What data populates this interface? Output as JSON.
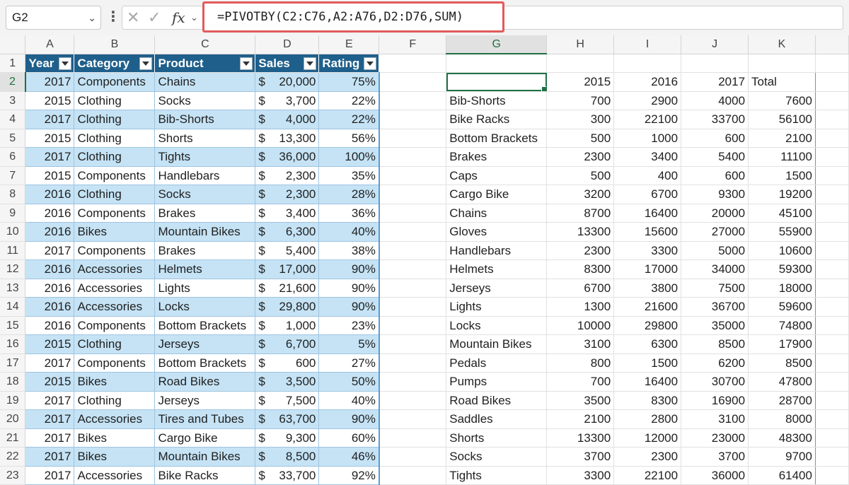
{
  "formula_bar": {
    "name_box": "G2",
    "formula": "=PIVOTBY(C2:C76,A2:A76,D2:D76,SUM)",
    "fx_label": "fx"
  },
  "columns": [
    "A",
    "B",
    "C",
    "D",
    "E",
    "F",
    "G",
    "H",
    "I",
    "J",
    "K"
  ],
  "rows": [
    "1",
    "2",
    "3",
    "4",
    "5",
    "6",
    "7",
    "8",
    "9",
    "10",
    "11",
    "12",
    "13",
    "14",
    "15",
    "16",
    "17",
    "18",
    "19",
    "20",
    "21",
    "22",
    "23"
  ],
  "table": {
    "headers": [
      "Year",
      "Category",
      "Product",
      "Sales",
      "Rating"
    ],
    "rows": [
      {
        "year": "2017",
        "category": "Components",
        "product": "Chains",
        "sales": "20,000",
        "rating": "75%"
      },
      {
        "year": "2015",
        "category": "Clothing",
        "product": "Socks",
        "sales": "3,700",
        "rating": "22%"
      },
      {
        "year": "2017",
        "category": "Clothing",
        "product": "Bib-Shorts",
        "sales": "4,000",
        "rating": "22%"
      },
      {
        "year": "2015",
        "category": "Clothing",
        "product": "Shorts",
        "sales": "13,300",
        "rating": "56%"
      },
      {
        "year": "2017",
        "category": "Clothing",
        "product": "Tights",
        "sales": "36,000",
        "rating": "100%"
      },
      {
        "year": "2015",
        "category": "Components",
        "product": "Handlebars",
        "sales": "2,300",
        "rating": "35%"
      },
      {
        "year": "2016",
        "category": "Clothing",
        "product": "Socks",
        "sales": "2,300",
        "rating": "28%"
      },
      {
        "year": "2016",
        "category": "Components",
        "product": "Brakes",
        "sales": "3,400",
        "rating": "36%"
      },
      {
        "year": "2016",
        "category": "Bikes",
        "product": "Mountain Bikes",
        "sales": "6,300",
        "rating": "40%"
      },
      {
        "year": "2017",
        "category": "Components",
        "product": "Brakes",
        "sales": "5,400",
        "rating": "38%"
      },
      {
        "year": "2016",
        "category": "Accessories",
        "product": "Helmets",
        "sales": "17,000",
        "rating": "90%"
      },
      {
        "year": "2016",
        "category": "Accessories",
        "product": "Lights",
        "sales": "21,600",
        "rating": "90%"
      },
      {
        "year": "2016",
        "category": "Accessories",
        "product": "Locks",
        "sales": "29,800",
        "rating": "90%"
      },
      {
        "year": "2016",
        "category": "Components",
        "product": "Bottom Brackets",
        "sales": "1,000",
        "rating": "23%"
      },
      {
        "year": "2015",
        "category": "Clothing",
        "product": "Jerseys",
        "sales": "6,700",
        "rating": "5%"
      },
      {
        "year": "2017",
        "category": "Components",
        "product": "Bottom Brackets",
        "sales": "600",
        "rating": "27%"
      },
      {
        "year": "2015",
        "category": "Bikes",
        "product": "Road Bikes",
        "sales": "3,500",
        "rating": "50%"
      },
      {
        "year": "2017",
        "category": "Clothing",
        "product": "Jerseys",
        "sales": "7,500",
        "rating": "40%"
      },
      {
        "year": "2017",
        "category": "Accessories",
        "product": "Tires and Tubes",
        "sales": "63,700",
        "rating": "90%"
      },
      {
        "year": "2017",
        "category": "Bikes",
        "product": "Cargo Bike",
        "sales": "9,300",
        "rating": "60%"
      },
      {
        "year": "2017",
        "category": "Bikes",
        "product": "Mountain Bikes",
        "sales": "8,500",
        "rating": "46%"
      },
      {
        "year": "2017",
        "category": "Accessories",
        "product": "Bike Racks",
        "sales": "33,700",
        "rating": "92%"
      }
    ]
  },
  "currency_symbol": "$",
  "pivot": {
    "headers": [
      "",
      "2015",
      "2016",
      "2017",
      "Total"
    ],
    "rows": [
      {
        "product": "Bib-Shorts",
        "y2015": "700",
        "y2016": "2900",
        "y2017": "4000",
        "total": "7600"
      },
      {
        "product": "Bike Racks",
        "y2015": "300",
        "y2016": "22100",
        "y2017": "33700",
        "total": "56100"
      },
      {
        "product": "Bottom Brackets",
        "y2015": "500",
        "y2016": "1000",
        "y2017": "600",
        "total": "2100"
      },
      {
        "product": "Brakes",
        "y2015": "2300",
        "y2016": "3400",
        "y2017": "5400",
        "total": "11100"
      },
      {
        "product": "Caps",
        "y2015": "500",
        "y2016": "400",
        "y2017": "600",
        "total": "1500"
      },
      {
        "product": "Cargo Bike",
        "y2015": "3200",
        "y2016": "6700",
        "y2017": "9300",
        "total": "19200"
      },
      {
        "product": "Chains",
        "y2015": "8700",
        "y2016": "16400",
        "y2017": "20000",
        "total": "45100"
      },
      {
        "product": "Gloves",
        "y2015": "13300",
        "y2016": "15600",
        "y2017": "27000",
        "total": "55900"
      },
      {
        "product": "Handlebars",
        "y2015": "2300",
        "y2016": "3300",
        "y2017": "5000",
        "total": "10600"
      },
      {
        "product": "Helmets",
        "y2015": "8300",
        "y2016": "17000",
        "y2017": "34000",
        "total": "59300"
      },
      {
        "product": "Jerseys",
        "y2015": "6700",
        "y2016": "3800",
        "y2017": "7500",
        "total": "18000"
      },
      {
        "product": "Lights",
        "y2015": "1300",
        "y2016": "21600",
        "y2017": "36700",
        "total": "59600"
      },
      {
        "product": "Locks",
        "y2015": "10000",
        "y2016": "29800",
        "y2017": "35000",
        "total": "74800"
      },
      {
        "product": "Mountain Bikes",
        "y2015": "3100",
        "y2016": "6300",
        "y2017": "8500",
        "total": "17900"
      },
      {
        "product": "Pedals",
        "y2015": "800",
        "y2016": "1500",
        "y2017": "6200",
        "total": "8500"
      },
      {
        "product": "Pumps",
        "y2015": "700",
        "y2016": "16400",
        "y2017": "30700",
        "total": "47800"
      },
      {
        "product": "Road Bikes",
        "y2015": "3500",
        "y2016": "8300",
        "y2017": "16900",
        "total": "28700"
      },
      {
        "product": "Saddles",
        "y2015": "2100",
        "y2016": "2800",
        "y2017": "3100",
        "total": "8000"
      },
      {
        "product": "Shorts",
        "y2015": "13300",
        "y2016": "12000",
        "y2017": "23000",
        "total": "48300"
      },
      {
        "product": "Socks",
        "y2015": "3700",
        "y2016": "2300",
        "y2017": "3700",
        "total": "9700"
      },
      {
        "product": "Tights",
        "y2015": "3300",
        "y2016": "22100",
        "y2017": "36000",
        "total": "61400"
      }
    ]
  },
  "colors": {
    "table_header": "#1f5f8b",
    "table_band": "#c5e3f5",
    "selection": "#1e7145",
    "formula_highlight": "#e25a5a"
  }
}
